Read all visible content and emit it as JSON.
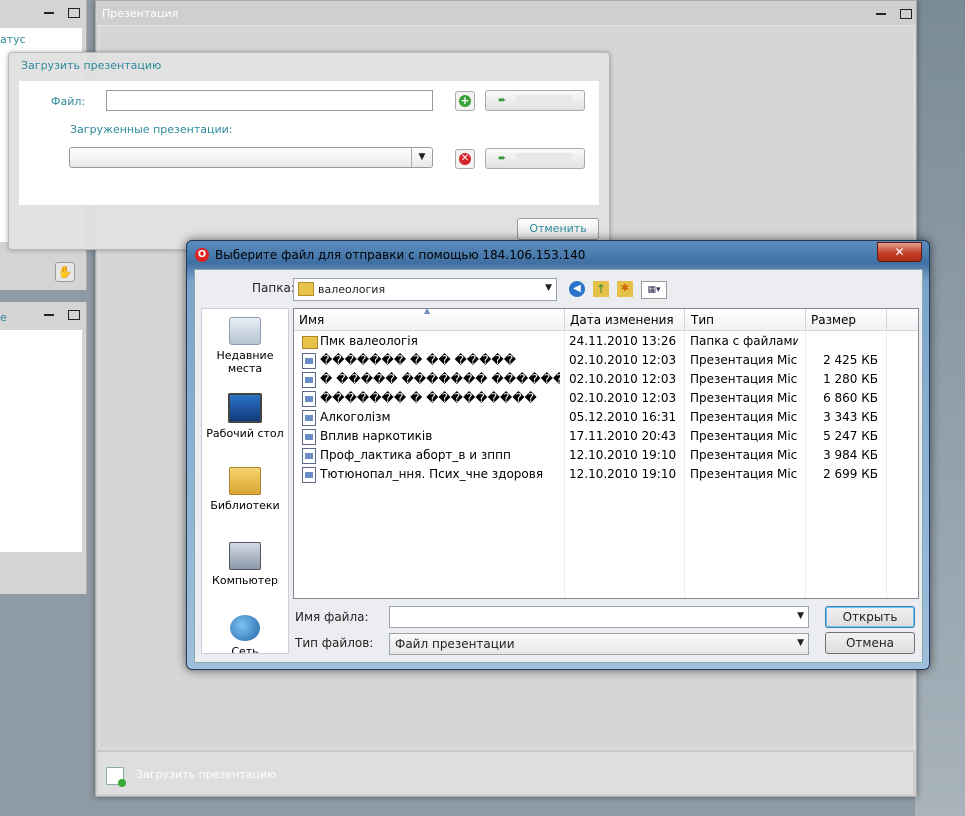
{
  "presentation_window": {
    "title": "Презентация",
    "footer_label": "Загрузить презентацию"
  },
  "left_panel": {
    "status_label": "атус",
    "panel2_label": "е"
  },
  "upload_dialog": {
    "title": "Загрузить презентацию",
    "file_label": "Файл:",
    "file_value": "",
    "uploaded_label": "Загруженные презентации:",
    "selected_presentation": "",
    "cancel_label": "Отменить"
  },
  "file_dialog": {
    "title": "Выберите файл для отправки с помощью 184.106.153.140",
    "close_symbol": "✕",
    "folder_label": "Папка:",
    "folder_value": "валеология",
    "places": [
      {
        "label": "Недавние места"
      },
      {
        "label": "Рабочий стол"
      },
      {
        "label": "Библиотеки"
      },
      {
        "label": "Компьютер"
      },
      {
        "label": "Сеть"
      }
    ],
    "columns": {
      "name": "Имя",
      "date": "Дата изменения",
      "type": "Тип",
      "size": "Размер"
    },
    "files": [
      {
        "name": "Пмк валеологія",
        "date": "24.11.2010 13:26",
        "type": "Папка с файлами",
        "size": "",
        "kind": "folder"
      },
      {
        "name": "������� � �� �����",
        "date": "02.10.2010 12:03",
        "type": "Презентация Mic...",
        "size": "2 425 КБ",
        "kind": "pres"
      },
      {
        "name": "� ����� ������� ������'...",
        "date": "02.10.2010 12:03",
        "type": "Презентация Mic...",
        "size": "1 280 КБ",
        "kind": "pres"
      },
      {
        "name": "������� � ���������",
        "date": "02.10.2010 12:03",
        "type": "Презентация Mic...",
        "size": "6 860 КБ",
        "kind": "pres"
      },
      {
        "name": "Алкоголізм",
        "date": "05.12.2010 16:31",
        "type": "Презентация Mic...",
        "size": "3 343 КБ",
        "kind": "pres"
      },
      {
        "name": "Вплив наркотиків",
        "date": "17.11.2010 20:43",
        "type": "Презентация Mic...",
        "size": "5 247 КБ",
        "kind": "pres"
      },
      {
        "name": "Проф_лактика аборт_в и зппп",
        "date": "12.10.2010 19:10",
        "type": "Презентация Mic...",
        "size": "3 984 КБ",
        "kind": "pres"
      },
      {
        "name": "Тютюнопал_ння. Псих_чне здоровя",
        "date": "12.10.2010 19:10",
        "type": "Презентация Mic...",
        "size": "2 699 КБ",
        "kind": "pres"
      }
    ],
    "filename_label": "Имя файла:",
    "filename_value": "",
    "filetype_label": "Тип файлов:",
    "filetype_value": "Файл презентации",
    "open_label": "Открыть",
    "cancel_label": "Отмена"
  }
}
